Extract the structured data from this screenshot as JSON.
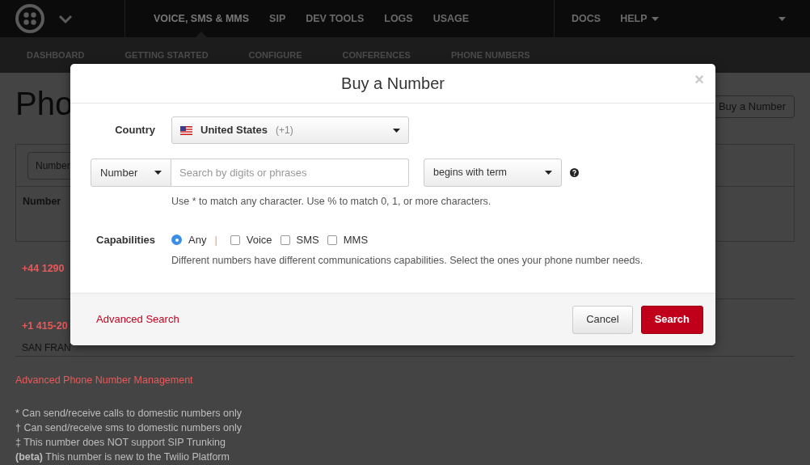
{
  "nav": {
    "items": [
      {
        "label": "VOICE, SMS & MMS",
        "selected": true
      },
      {
        "label": "SIP",
        "selected": false
      },
      {
        "label": "DEV TOOLS",
        "selected": false
      },
      {
        "label": "LOGS",
        "selected": false
      },
      {
        "label": "USAGE",
        "selected": false
      }
    ],
    "right_items": [
      {
        "label": "DOCS",
        "dropdown": false
      },
      {
        "label": "HELP",
        "dropdown": true
      }
    ]
  },
  "subnav": {
    "items": [
      "DASHBOARD",
      "GETTING STARTED",
      "CONFIGURE",
      "CONFERENCES",
      "PHONE NUMBERS"
    ]
  },
  "page": {
    "title": "Pho",
    "buy_button": "Buy a Number",
    "filter": "Number",
    "column_1": "Number",
    "rows": [
      {
        "number": "+44 1290"
      },
      {
        "number": "+1 415-20",
        "location": "SAN FRAN"
      }
    ],
    "link": "Advanced Phone Number Management",
    "footnotes": [
      "* Can send/receive calls to domestic numbers only",
      "† Can send/receive sms to domestic numbers only",
      "‡ This number does NOT support SIP Trunking",
      "**(beta)** This number is new to the Twilio Platform"
    ]
  },
  "modal": {
    "title": "Buy a Number",
    "close": "×",
    "country_label": "Country",
    "country": {
      "name": "United States",
      "code": "(+1)"
    },
    "search_type": "Number",
    "search": {
      "placeholder": "Search by digits or phrases"
    },
    "match": "begins with term",
    "hint": "Use * to match any character. Use % to match 0, 1, or more characters.",
    "capabilities_label": "Capabilities",
    "capabilities": [
      {
        "label": "Any",
        "kind": "radio",
        "checked": true
      },
      {
        "label": "Voice",
        "kind": "checkbox",
        "checked": false
      },
      {
        "label": "SMS",
        "kind": "checkbox",
        "checked": false
      },
      {
        "label": "MMS",
        "kind": "checkbox",
        "checked": false
      }
    ],
    "separator": "|",
    "capabilities_hint": "Different numbers have different communications capabilities. Select the ones your phone number needs.",
    "advanced_link": "Advanced Search",
    "cancel": "Cancel",
    "search_button": "Search"
  }
}
